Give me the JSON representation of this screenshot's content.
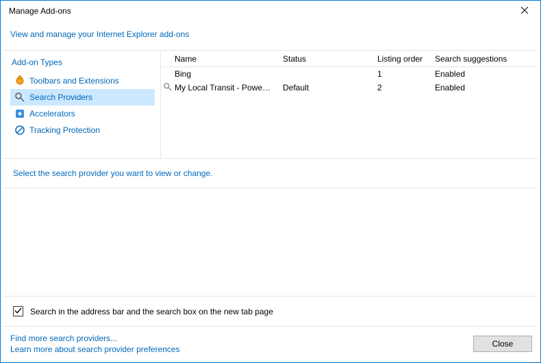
{
  "titlebar": {
    "title": "Manage Add-ons"
  },
  "header_link": "View and manage your Internet Explorer add-ons",
  "sidebar": {
    "header": "Add-on Types",
    "items": [
      {
        "label": "Toolbars and Extensions",
        "icon": "puzzle"
      },
      {
        "label": "Search Providers",
        "icon": "search"
      },
      {
        "label": "Accelerators",
        "icon": "accel"
      },
      {
        "label": "Tracking Protection",
        "icon": "block"
      }
    ]
  },
  "table": {
    "columns": {
      "name": "Name",
      "status": "Status",
      "order": "Listing order",
      "sugg": "Search suggestions"
    },
    "rows": [
      {
        "name": "Bing",
        "status": "",
        "order": "1",
        "sugg": "Enabled"
      },
      {
        "name": "My Local Transit - Powered by Y...",
        "status": "Default",
        "order": "2",
        "sugg": "Enabled"
      }
    ]
  },
  "instruction": "Select the search provider you want to view or change.",
  "checkbox": {
    "label": "Search in the address bar and the search box on the new tab page",
    "checked": true
  },
  "footer": {
    "link1": "Find more search providers...",
    "link2": "Learn more about search provider preferences",
    "close": "Close"
  }
}
